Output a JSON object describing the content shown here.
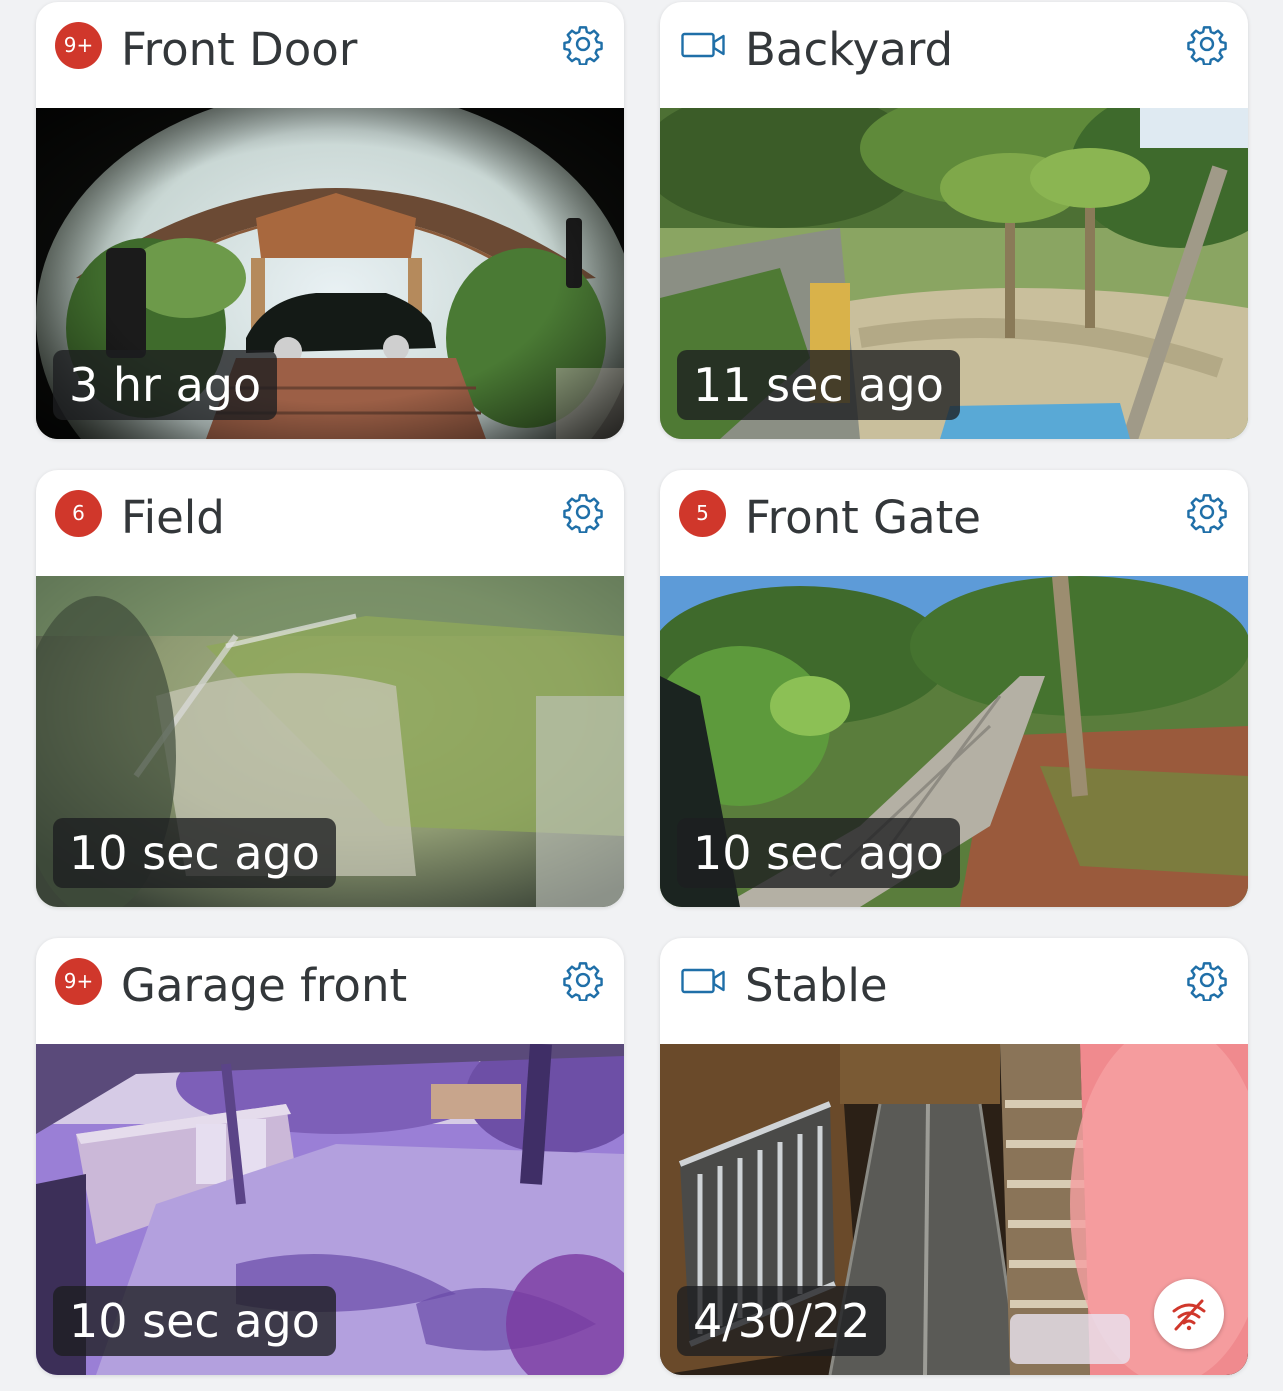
{
  "cameras": [
    {
      "name": "Front Door",
      "badge": "9+",
      "has_badge": true,
      "icon": "video-camera-icon",
      "timestamp": "3 hr ago",
      "scene": "doorbell view of covered porch with parked black sedan and brick driveway",
      "offline": false
    },
    {
      "name": "Backyard",
      "badge": "",
      "has_badge": false,
      "icon": "video-camera-icon",
      "timestamp": "11 sec ago",
      "scene": "elevated view of tropical backyard with palm trees and sandy path",
      "offline": false
    },
    {
      "name": "Field",
      "badge": "6",
      "has_badge": true,
      "icon": "video-camera-icon",
      "timestamp": "10 sec ago",
      "scene": "blurry view of grassy field with wooden fence",
      "offline": false
    },
    {
      "name": "Front Gate",
      "badge": "5",
      "has_badge": true,
      "icon": "video-camera-icon",
      "timestamp": "10 sec ago",
      "scene": "paved driveway lined with palm trees and tropical plants",
      "offline": false
    },
    {
      "name": "Garage front",
      "badge": "9+",
      "has_badge": true,
      "icon": "video-camera-icon",
      "timestamp": "10 sec ago",
      "scene": "purple-tinted infrared view of garage and driveway",
      "offline": false
    },
    {
      "name": "Stable",
      "badge": "",
      "has_badge": false,
      "icon": "video-camera-icon",
      "timestamp": "4/30/22",
      "scene": "fisheye view of horse stable aisle",
      "offline": true
    }
  ],
  "colors": {
    "badge": "#d0372b",
    "accent": "#1f6fa8",
    "title": "#33373a",
    "offline_icon": "#d0372b"
  }
}
